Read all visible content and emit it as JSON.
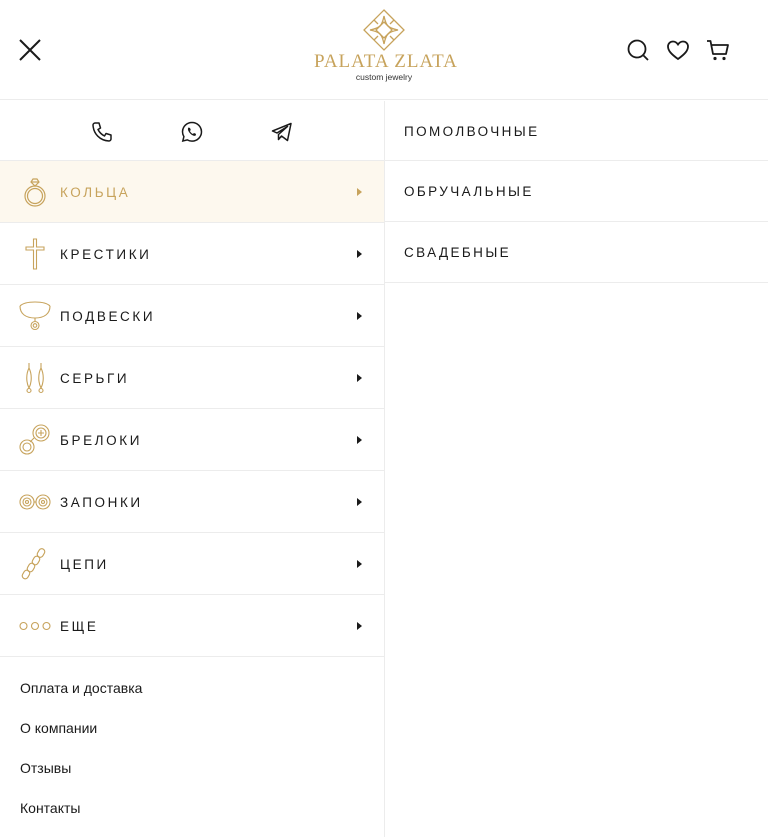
{
  "brand": {
    "logo_text": "PALATA ZLATA",
    "logo_subtitle": "custom jewelry",
    "accent_color": "#c7a35c",
    "logo_icon": "diamond-star-logo-icon"
  },
  "header": {
    "close_icon": "close-icon",
    "icons": [
      "search-icon",
      "heart-icon",
      "cart-icon"
    ]
  },
  "contacts": {
    "icons": [
      "phone-icon",
      "whatsapp-icon",
      "telegram-icon"
    ]
  },
  "categories": [
    {
      "label": "Кольца",
      "icon": "ring-icon",
      "active": true
    },
    {
      "label": "Крестики",
      "icon": "cross-icon",
      "active": false
    },
    {
      "label": "Подвески",
      "icon": "pendant-icon",
      "active": false
    },
    {
      "label": "Серьги",
      "icon": "earrings-icon",
      "active": false
    },
    {
      "label": "Брелоки",
      "icon": "keychain-icon",
      "active": false
    },
    {
      "label": "Запонки",
      "icon": "cufflinks-icon",
      "active": false
    },
    {
      "label": "Цепи",
      "icon": "chain-icon",
      "active": false
    },
    {
      "label": "Еще",
      "icon": "more-dots-icon",
      "active": false
    }
  ],
  "links": [
    "Оплата и доставка",
    "О компании",
    "Отзывы",
    "Контакты"
  ],
  "subcategories": [
    "Помолвочные",
    "Обручальные",
    "Свадебные"
  ]
}
